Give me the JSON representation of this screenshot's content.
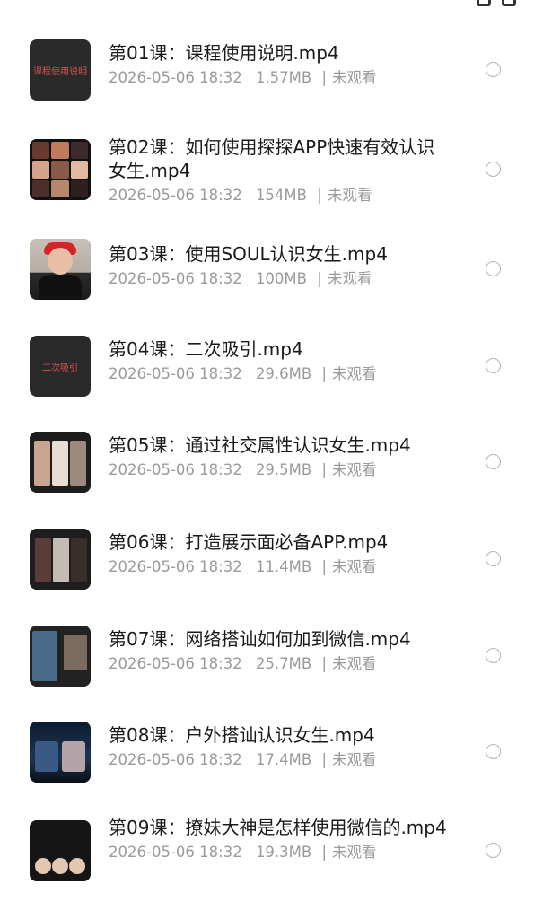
{
  "courses": [
    {
      "title": "第01课：课程使用说明.mp4",
      "date": "2026-05-06 18:32",
      "size": "1.57MB",
      "status": "未观看",
      "thumb_text": "课程使用说明"
    },
    {
      "title": "第02课：如何使用探探APP快速有效认识女生.mp4",
      "date": "2026-05-06 18:32",
      "size": "154MB",
      "status": "未观看"
    },
    {
      "title": "第03课：使用SOUL认识女生.mp4",
      "date": "2026-05-06 18:32",
      "size": "100MB",
      "status": "未观看"
    },
    {
      "title": "第04课：二次吸引.mp4",
      "date": "2026-05-06 18:32",
      "size": "29.6MB",
      "status": "未观看",
      "thumb_text": "二次吸引"
    },
    {
      "title": "第05课：通过社交属性认识女生.mp4",
      "date": "2026-05-06 18:32",
      "size": "29.5MB",
      "status": "未观看"
    },
    {
      "title": "第06课：打造展示面必备APP.mp4",
      "date": "2026-05-06 18:32",
      "size": "11.4MB",
      "status": "未观看"
    },
    {
      "title": "第07课：网络搭讪如何加到微信.mp4",
      "date": "2026-05-06 18:32",
      "size": "25.7MB",
      "status": "未观看"
    },
    {
      "title": "第08课：户外搭讪认识女生.mp4",
      "date": "2026-05-06 18:32",
      "size": "17.4MB",
      "status": "未观看"
    },
    {
      "title": "第09课：撩妹大神是怎样使用微信的.mp4",
      "date": "2026-05-06 18:32",
      "size": "19.3MB",
      "status": "未观看"
    }
  ],
  "meta_separator": "|",
  "colors": {
    "title": "#1a1a1a",
    "meta": "#9a9a9a",
    "radio_border": "#b5b5b5",
    "thumb_dark": "#2a2a2a",
    "thumb_red_text": "#d9534f"
  }
}
